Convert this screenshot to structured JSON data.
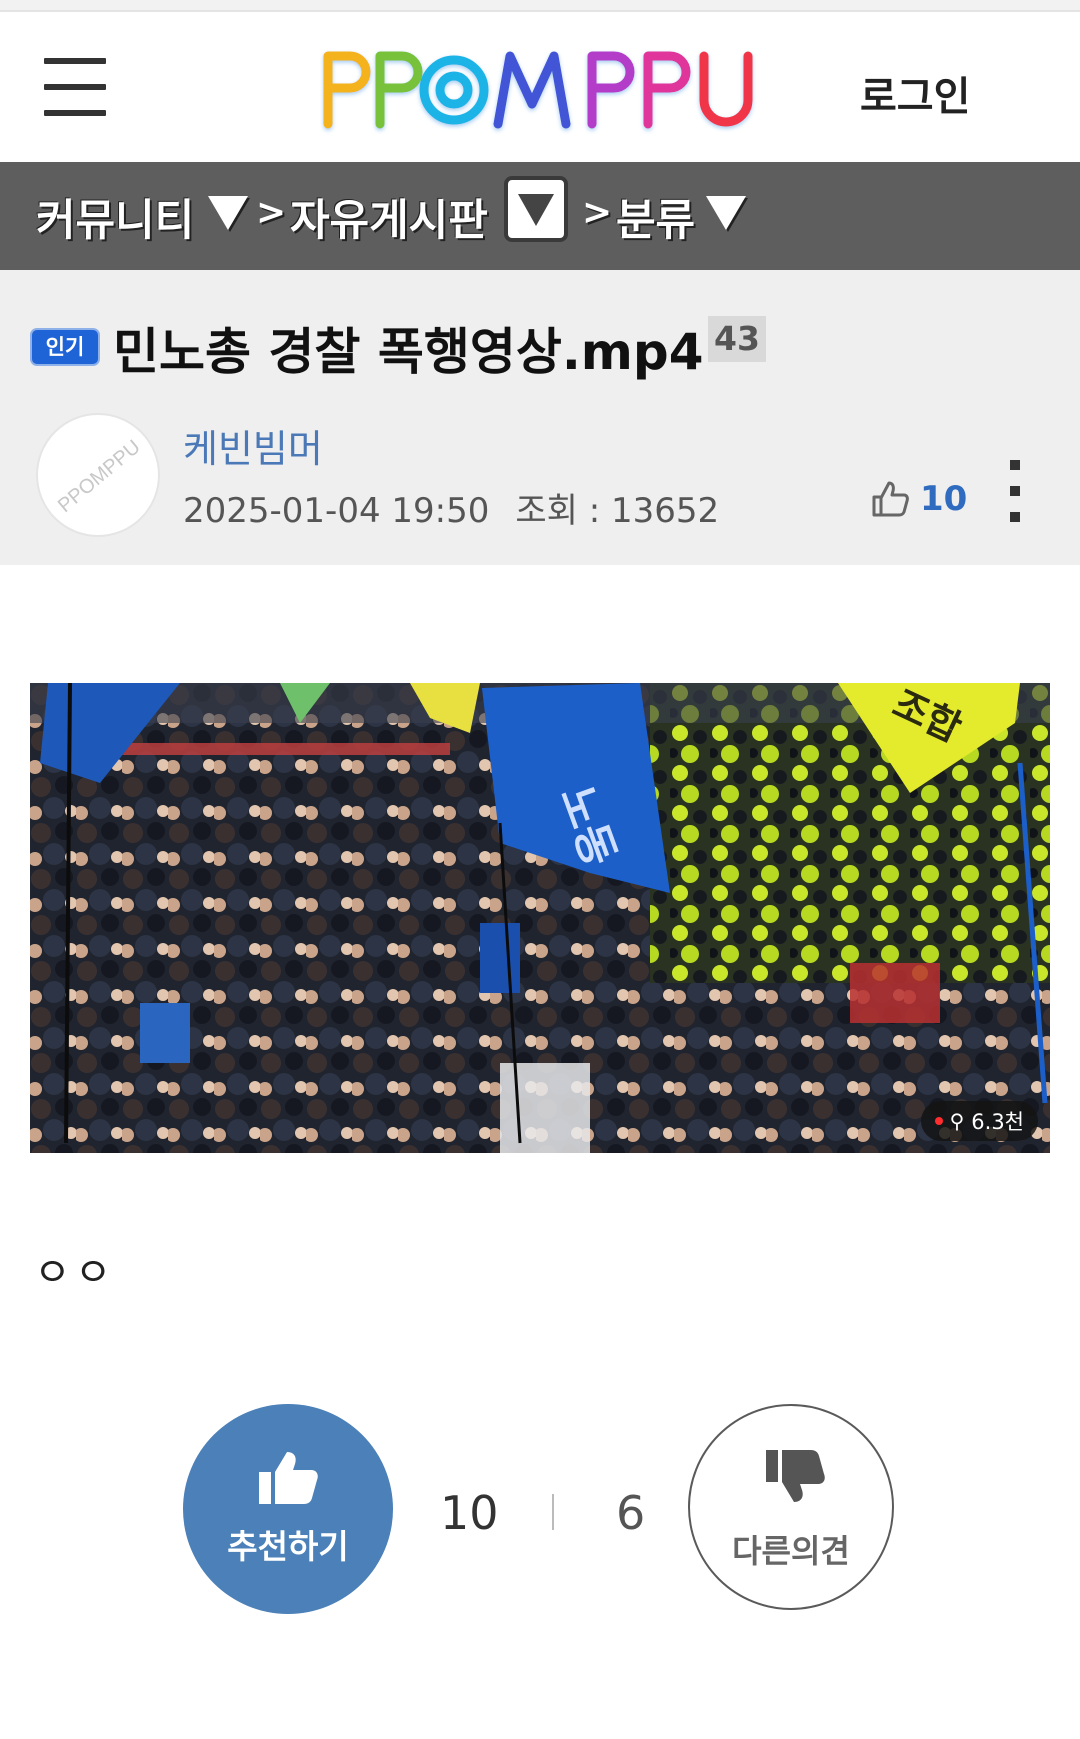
{
  "header": {
    "logo_text": "PPOMPPU",
    "login_label": "로그인"
  },
  "breadcrumb": {
    "community": "커뮤니티",
    "board": "자유게시판",
    "category": "분류",
    "separator": ">"
  },
  "post": {
    "badge": "인기",
    "title": "민노총 경찰 폭행영상.mp4",
    "comment_count": "43",
    "avatar_watermark": "PPOMPPU",
    "author": "케빈빔머",
    "datetime": "2025-01-04 19:50",
    "views": "조회 : 13652",
    "likes": "10",
    "body": "ㅇㅇ"
  },
  "video": {
    "viewer_count": "6.3천",
    "flag_text_left": "노동",
    "flag_text_right": "조합"
  },
  "vote": {
    "recommend_label": "추천하기",
    "up_count": "10",
    "down_count": "6",
    "dissent_label": "다른의견"
  },
  "colors": {
    "breadcrumb_bg": "#5e5e5e",
    "accent_blue": "#4b80b8",
    "author_blue": "#4b79b8",
    "hot_badge": "#1f64d6"
  }
}
